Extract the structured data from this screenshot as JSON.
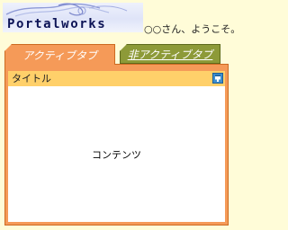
{
  "header": {
    "logo_text": "Portalworks",
    "welcome_text": "○○さん、ようこそ。"
  },
  "tabs": [
    {
      "label": "アクティブタブ",
      "active": true
    },
    {
      "label": "非アクティブタブ",
      "active": false
    }
  ],
  "portlet": {
    "title": "タイトル",
    "content": "コンテンツ",
    "header_icon": "popup-window-icon"
  },
  "colors": {
    "page_background": "#fffcd8",
    "active_tab": "#f59a58",
    "inactive_tab": "#8d9a38",
    "panel_header": "#ffd06a",
    "logo_text": "#0d1456"
  }
}
